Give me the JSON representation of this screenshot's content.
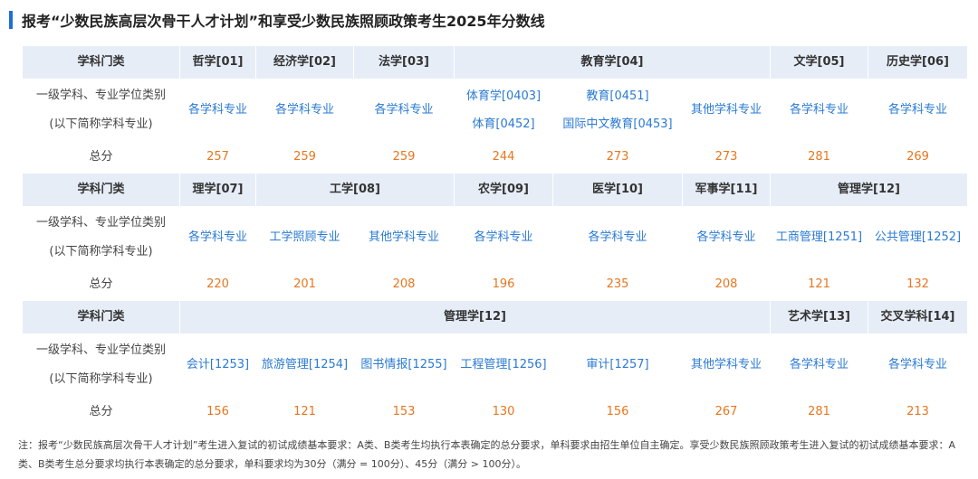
{
  "title": "报考“少数民族高层次骨干人才计划”和享受少数民族照顾政策考生2025年分数线",
  "labels": {
    "header": "学科门类",
    "sub_line1": "一级学科、专业学位类别",
    "sub_line2": "(以下简称学科专业)",
    "total": "总分"
  },
  "section1": {
    "headers": [
      "哲学[01]",
      "经济学[02]",
      "法学[03]",
      "教育学[04]",
      "文学[05]",
      "历史学[06]"
    ],
    "subjects": [
      [
        "各学科专业"
      ],
      [
        "各学科专业"
      ],
      [
        "各学科专业"
      ],
      [
        "体育学[0403]",
        "体育[0452]"
      ],
      [
        "教育[0451]",
        "国际中文教育[0453]"
      ],
      [
        "其他学科专业"
      ],
      [
        "各学科专业"
      ],
      [
        "各学科专业"
      ]
    ],
    "totals": [
      "257",
      "259",
      "259",
      "244",
      "273",
      "273",
      "281",
      "269"
    ]
  },
  "section2": {
    "headers": [
      "理学[07]",
      "工学[08]",
      "农学[09]",
      "医学[10]",
      "军事学[11]",
      "管理学[12]"
    ],
    "subjects": [
      "各学科专业",
      "工学照顾专业",
      "其他学科专业",
      "各学科专业",
      "各学科专业",
      "各学科专业",
      "工商管理[1251]",
      "公共管理[1252]"
    ],
    "totals": [
      "220",
      "201",
      "208",
      "196",
      "235",
      "208",
      "121",
      "132"
    ]
  },
  "section3": {
    "headers": [
      "管理学[12]",
      "艺术学[13]",
      "交叉学科[14]"
    ],
    "subjects": [
      "会计[1253]",
      "旅游管理[1254]",
      "图书情报[1255]",
      "工程管理[1256]",
      "审计[1257]",
      "其他学科专业",
      "各学科专业",
      "各学科专业"
    ],
    "totals": [
      "156",
      "121",
      "153",
      "130",
      "156",
      "267",
      "281",
      "213"
    ]
  },
  "note": "注：报考“少数民族高层次骨干人才计划”考生进入复试的初试成绩基本要求：A类、B类考生均执行本表确定的总分要求，单科要求由招生单位自主确定。享受少数民族照顾政策考生进入复试的初试成绩基本要求：A类、B类考生总分要求均执行本表确定的总分要求，单科要求均为30分（满分 = 100分）、45分（满分 > 100分）。",
  "colors": {
    "accent": "#1f6fd1",
    "header_bg": "#e7edf7",
    "link": "#2a7ad2",
    "score": "#e8761e"
  }
}
